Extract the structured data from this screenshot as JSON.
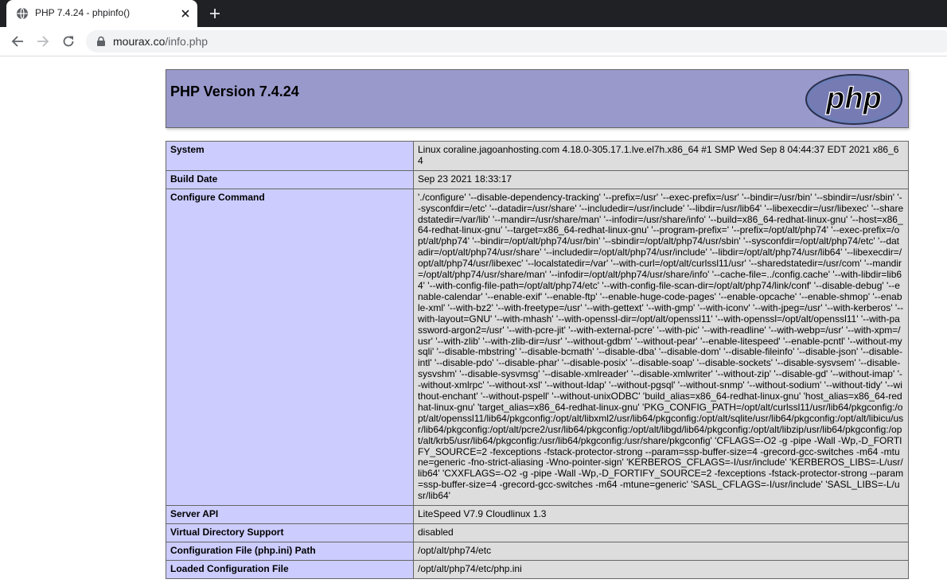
{
  "browser": {
    "tab_title": "PHP 7.4.24 - phpinfo()",
    "url_domain": "mourax.co",
    "url_path": "/info.php",
    "icons": {
      "favicon": "globe-icon",
      "close": "close-icon",
      "new_tab": "plus-icon",
      "back": "back-arrow-icon",
      "forward": "forward-arrow-icon",
      "reload": "reload-icon",
      "secure": "lock-icon"
    }
  },
  "header": {
    "title": "PHP Version 7.4.24",
    "logo_text": "php"
  },
  "rows": [
    {
      "key": "System",
      "value": "Linux coraline.jagoanhosting.com 4.18.0-305.17.1.lve.el7h.x86_64 #1 SMP Wed Sep 8 04:44:37 EDT 2021 x86_64"
    },
    {
      "key": "Build Date",
      "value": "Sep 23 2021 18:33:17"
    },
    {
      "key": "Configure Command",
      "value": "'./configure' '--disable-dependency-tracking' '--prefix=/usr' '--exec-prefix=/usr' '--bindir=/usr/bin' '--sbindir=/usr/sbin' '--sysconfdir=/etc' '--datadir=/usr/share' '--includedir=/usr/include' '--libdir=/usr/lib64' '--libexecdir=/usr/libexec' '--sharedstatedir=/var/lib' '--mandir=/usr/share/man' '--infodir=/usr/share/info' '--build=x86_64-redhat-linux-gnu' '--host=x86_64-redhat-linux-gnu' '--target=x86_64-redhat-linux-gnu' '--program-prefix=' '--prefix=/opt/alt/php74' '--exec-prefix=/opt/alt/php74' '--bindir=/opt/alt/php74/usr/bin' '--sbindir=/opt/alt/php74/usr/sbin' '--sysconfdir=/opt/alt/php74/etc' '--datadir=/opt/alt/php74/usr/share' '--includedir=/opt/alt/php74/usr/include' '--libdir=/opt/alt/php74/usr/lib64' '--libexecdir=/opt/alt/php74/usr/libexec' '--localstatedir=/var' '--with-curl=/opt/alt/curlssl11/usr' '--sharedstatedir=/usr/com' '--mandir=/opt/alt/php74/usr/share/man' '--infodir=/opt/alt/php74/usr/share/info' '--cache-file=../config.cache' '--with-libdir=lib64' '--with-config-file-path=/opt/alt/php74/etc' '--with-config-file-scan-dir=/opt/alt/php74/link/conf' '--disable-debug' '--enable-calendar' '--enable-exif' '--enable-ftp' '--enable-huge-code-pages' '--enable-opcache' '--enable-shmop' '--enable-xml' '--with-bz2' '--with-freetype=/usr' '--with-gettext' '--with-gmp' '--with-iconv' '--with-jpeg=/usr' '--with-kerberos' '--with-layout=GNU' '--with-mhash' '--with-openssl-dir=/opt/alt/openssl11' '--with-openssl=/opt/alt/openssl11' '--with-password-argon2=/usr' '--with-pcre-jit' '--with-external-pcre' '--with-pic' '--with-readline' '--with-webp=/usr' '--with-xpm=/usr' '--with-zlib' '--with-zlib-dir=/usr' '--without-gdbm' '--without-pear' '--enable-litespeed' '--enable-pcntl' '--without-mysqli' '--disable-mbstring' '--disable-bcmath' '--disable-dba' '--disable-dom' '--disable-fileinfo' '--disable-json' '--disable-intl' '--disable-pdo' '--disable-phar' '--disable-posix' '--disable-soap' '--disable-sockets' '--disable-sysvsem' '--disable-sysvshm' '--disable-sysvmsg' '--disable-xmlreader' '--disable-xmlwriter' '--without-zip' '--disable-gd' '--without-imap' '--without-xmlrpc' '--without-xsl' '--without-ldap' '--without-pgsql' '--without-snmp' '--without-sodium' '--without-tidy' '--without-enchant' '--without-pspell' '--without-unixODBC' 'build_alias=x86_64-redhat-linux-gnu' 'host_alias=x86_64-redhat-linux-gnu' 'target_alias=x86_64-redhat-linux-gnu' 'PKG_CONFIG_PATH=/opt/alt/curlssl11/usr/lib64/pkgconfig:/opt/alt/openssl11/lib64/pkgconfig:/opt/alt/libxml2/usr/lib64/pkgconfig:/opt/alt/sqlite/usr/lib64/pkgconfig:/opt/alt/libicu/usr/lib64/pkgconfig:/opt/alt/pcre2/usr/lib64/pkgconfig:/opt/alt/libgd/lib64/pkgconfig:/opt/alt/libzip/usr/lib64/pkgconfig:/opt/alt/krb5/usr/lib64/pkgconfig:/usr/lib64/pkgconfig:/usr/share/pkgconfig' 'CFLAGS=-O2 -g -pipe -Wall -Wp,-D_FORTIFY_SOURCE=2 -fexceptions -fstack-protector-strong --param=ssp-buffer-size=4 -grecord-gcc-switches -m64 -mtune=generic -fno-strict-aliasing -Wno-pointer-sign' 'KERBEROS_CFLAGS=-I/usr/include' 'KERBEROS_LIBS=-L/usr/lib64' 'CXXFLAGS=-O2 -g -pipe -Wall -Wp,-D_FORTIFY_SOURCE=2 -fexceptions -fstack-protector-strong --param=ssp-buffer-size=4 -grecord-gcc-switches -m64 -mtune=generic' 'SASL_CFLAGS=-I/usr/include' 'SASL_LIBS=-L/usr/lib64'"
    },
    {
      "key": "Server API",
      "value": "LiteSpeed V7.9 Cloudlinux 1.3"
    },
    {
      "key": "Virtual Directory Support",
      "value": "disabled"
    },
    {
      "key": "Configuration File (php.ini) Path",
      "value": "/opt/alt/php74/etc"
    },
    {
      "key": "Loaded Configuration File",
      "value": "/opt/alt/php74/etc/php.ini"
    }
  ],
  "colors": {
    "header_bg": "#9999cc",
    "key_bg": "#ccccff",
    "value_bg": "#dddddd",
    "border": "#666666"
  }
}
